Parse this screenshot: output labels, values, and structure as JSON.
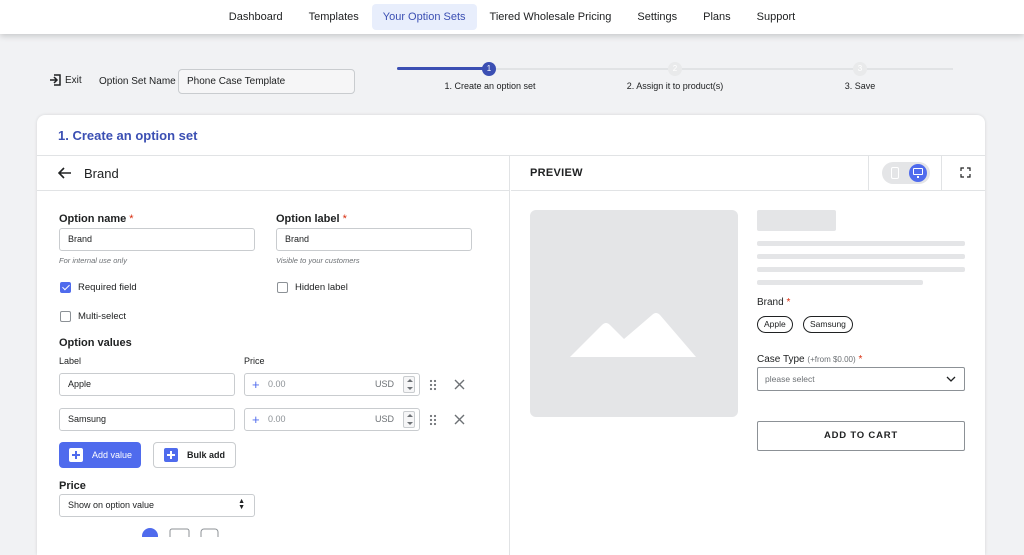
{
  "nav": {
    "items": [
      {
        "label": "Dashboard"
      },
      {
        "label": "Templates"
      },
      {
        "label": "Your Option Sets"
      },
      {
        "label": "Tiered Wholesale Pricing"
      },
      {
        "label": "Settings"
      },
      {
        "label": "Plans"
      },
      {
        "label": "Support"
      }
    ],
    "active": "Your Option Sets"
  },
  "header": {
    "exit_label": "Exit",
    "option_set_name_label": "Option Set Name",
    "option_set_name_value": "Phone Case Template"
  },
  "stepper": {
    "current_step": 1,
    "steps": [
      {
        "number": "1",
        "label": "1. Create an option set"
      },
      {
        "number": "2",
        "label": "2. Assign it to product(s)"
      },
      {
        "number": "3",
        "label": "3. Save"
      }
    ]
  },
  "card": {
    "title": "1. Create an option set"
  },
  "editor": {
    "title": "Brand",
    "option_name": {
      "label": "Option name",
      "required_mark": "*",
      "value": "Brand",
      "help": "For internal use only"
    },
    "option_label": {
      "label": "Option label",
      "required_mark": "*",
      "value": "Brand",
      "help": "Visible to your customers"
    },
    "required_field": {
      "label": "Required field",
      "checked": true
    },
    "hidden_label": {
      "label": "Hidden label",
      "checked": false
    },
    "multi_select": {
      "label": "Multi-select",
      "checked": false
    },
    "option_values": {
      "title": "Option values",
      "label_header": "Label",
      "price_header": "Price",
      "rows": [
        {
          "label": "Apple",
          "price_sign": "+",
          "price": "0.00",
          "currency": "USD"
        },
        {
          "label": "Samsung",
          "price_sign": "+",
          "price": "0.00",
          "currency": "USD"
        }
      ]
    },
    "add_value_label": "Add value",
    "bulk_add_label": "Bulk add",
    "price": {
      "title": "Price",
      "selected": "Show on option value"
    }
  },
  "preview": {
    "title": "PREVIEW",
    "device": "desktop",
    "brand_label": "Brand",
    "brand_required": "*",
    "brand_values": [
      "Apple",
      "Samsung"
    ],
    "case_type_label": "Case Type",
    "case_type_sub": "(+from $0.00)",
    "case_type_required": "*",
    "case_type_placeholder": "please select",
    "add_to_cart": "ADD TO CART"
  },
  "colors": {
    "accent": "#4f6bed",
    "title_blue": "#3b4fb3",
    "required_red": "#d82c0d"
  }
}
